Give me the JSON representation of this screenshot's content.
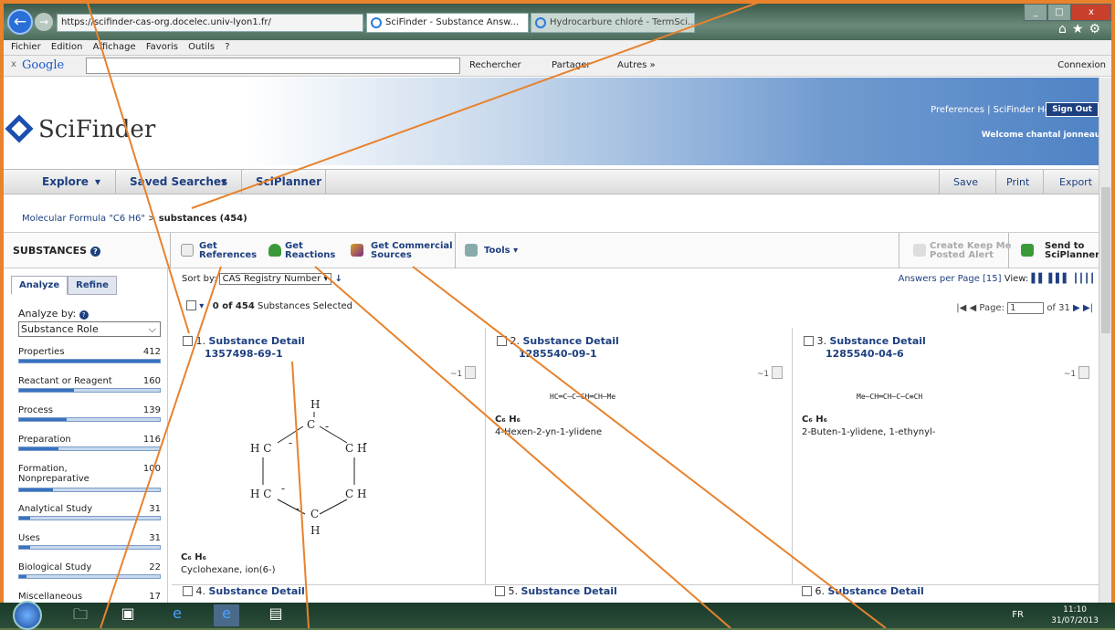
{
  "browser": {
    "url": "https://scifinder-cas-org.docelec.univ-lyon1.fr/",
    "tabs": [
      {
        "label": "SciFinder - Substance Answ..."
      },
      {
        "label": "Hydrocarbure chloré - TermSci..."
      }
    ],
    "menu": [
      "Fichier",
      "Edition",
      "Affichage",
      "Favoris",
      "Outils",
      "?"
    ],
    "google_logo": "Google",
    "google_search": "Rechercher",
    "google_share": "Partager",
    "google_more": "Autres »",
    "google_connect": "Connexion"
  },
  "header": {
    "logo": "SciFinder",
    "preferences": "Preferences | SciFinder Help",
    "sign_out": "Sign Out",
    "welcome": "Welcome chantal jonneaux"
  },
  "nav": {
    "explore": "Explore",
    "saved": "Saved Searches",
    "sciplanner": "SciPlanner",
    "save": "Save",
    "print": "Print",
    "export": "Export"
  },
  "breadcrumb": {
    "parent": "Molecular Formula \"C6 H6\"",
    "sep": ">",
    "current": "substances (454)"
  },
  "toolbar": {
    "title": "SUBSTANCES",
    "get_references": [
      "Get",
      "References"
    ],
    "get_reactions": [
      "Get",
      "Reactions"
    ],
    "get_commercial": [
      "Get Commercial",
      "Sources"
    ],
    "tools": "Tools",
    "keepme": [
      "Create Keep Me",
      "Posted Alert"
    ],
    "send": [
      "Send to",
      "SciPlanner"
    ]
  },
  "left": {
    "tab_analyze": "Analyze",
    "tab_refine": "Refine",
    "analyze_by": "Analyze by:",
    "role": "Substance Role",
    "rows": [
      {
        "label": "Properties",
        "count": "412",
        "frac": 1.0
      },
      {
        "label": "Reactant or Reagent",
        "count": "160",
        "frac": 0.39
      },
      {
        "label": "Process",
        "count": "139",
        "frac": 0.34
      },
      {
        "label": "Preparation",
        "count": "116",
        "frac": 0.28
      },
      {
        "label": "Formation,",
        "label2": "Nonpreparative",
        "count": "100",
        "frac": 0.24
      },
      {
        "label": "Analytical Study",
        "count": "31",
        "frac": 0.08
      },
      {
        "label": "Uses",
        "count": "31",
        "frac": 0.08
      },
      {
        "label": "Biological Study",
        "count": "22",
        "frac": 0.05
      },
      {
        "label": "Miscellaneous",
        "count": "17",
        "frac": 0.04
      }
    ]
  },
  "results": {
    "sort_label": "Sort by:",
    "sort_value": "CAS Registry Number",
    "answers_per_page": "Answers per Page [15]",
    "view": "View:",
    "selected": "0 of 454",
    "selected_suffix": "Substances Selected",
    "page_label": "Page:",
    "page_value": "1",
    "page_total": "of 31",
    "cards": [
      {
        "num": "1.",
        "title": "Substance Detail",
        "reg": "1357498-69-1",
        "formula": "C₆ H₆",
        "name": "Cyclohexane, ion(6-)",
        "sim": "~1"
      },
      {
        "num": "2.",
        "title": "Substance Detail",
        "reg": "1285540-09-1",
        "formula": "C₆ H₆",
        "name": "4-Hexen-2-yn-1-ylidene",
        "sim": "~1",
        "struct": "HC═C─C─CH═CH─Me"
      },
      {
        "num": "3.",
        "title": "Substance Detail",
        "reg": "1285540-04-6",
        "formula": "C₆ H₆",
        "name": "2-Buten-1-ylidene, 1-ethynyl-",
        "sim": "~1",
        "struct": "Me─CH═CH─C─C≡CH"
      },
      {
        "num": "4.",
        "title": "Substance Detail"
      },
      {
        "num": "5.",
        "title": "Substance Detail"
      },
      {
        "num": "6.",
        "title": "Substance Detail"
      }
    ]
  },
  "taskbar": {
    "lang": "FR",
    "time": "11:10",
    "date": "31/07/2013"
  },
  "colors": {
    "accent": "#1d3f80",
    "annotation": "#e8822c"
  }
}
